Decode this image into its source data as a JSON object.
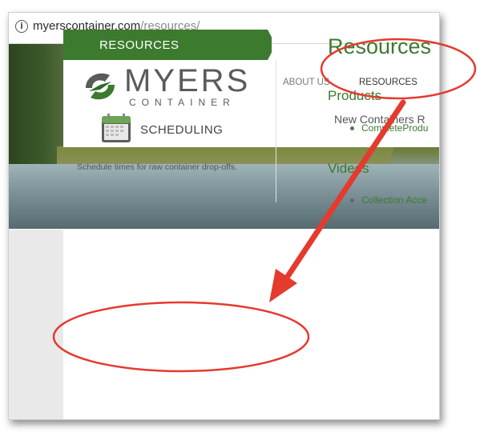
{
  "browser": {
    "url_domain": "myerscontainer.com",
    "url_path": "/resources/",
    "info_icon": "info-circle-icon"
  },
  "header": {
    "logo_word": "MYERS",
    "logo_sub": "CONTAINER",
    "nav": {
      "about": "ABOUT US",
      "resources": "RESOURCES"
    },
    "subnav": "New Containers   R"
  },
  "sidebar": {
    "banner": "RESOURCES",
    "scheduling": {
      "icon": "calendar-icon",
      "title": "SCHEDULING",
      "description": "Schedule times for raw container drop-offs."
    }
  },
  "main": {
    "title": "Resources",
    "sections": [
      {
        "heading": "Products",
        "items": [
          "CompleteProdu"
        ]
      },
      {
        "heading": "Videos",
        "items": [
          "Collection Acce"
        ]
      }
    ]
  },
  "annotation": {
    "color": "#e53a2e"
  },
  "colors": {
    "brand_green": "#3c7a2e",
    "logo_gray": "#5b5b5b"
  }
}
